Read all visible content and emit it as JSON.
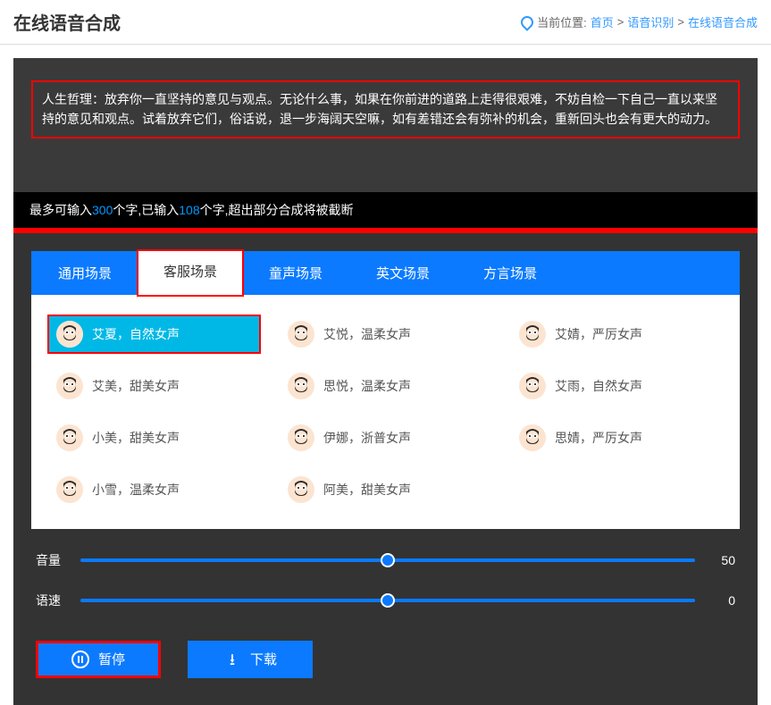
{
  "header": {
    "title": "在线语音合成",
    "breadcrumb": {
      "label": "当前位置:",
      "items": [
        "首页",
        "语音识别",
        "在线语音合成"
      ]
    }
  },
  "textarea": {
    "value": "人生哲理：放弃你一直坚持的意见与观点。无论什么事，如果在你前进的道路上走得很艰难，不妨自检一下自己一直以来坚持的意见和观点。试着放弃它们，俗话说，退一步海阔天空嘛，如有差错还会有弥补的机会，重新回头也会有更大的动力。"
  },
  "counter": {
    "prefix": "最多可输入",
    "max": "300",
    "mid1": "个字,已输入",
    "current": "108",
    "suffix": "个字,超出部分合成将被截断"
  },
  "tabs": [
    {
      "label": "通用场景",
      "active": false
    },
    {
      "label": "客服场景",
      "active": true
    },
    {
      "label": "童声场景",
      "active": false
    },
    {
      "label": "英文场景",
      "active": false
    },
    {
      "label": "方言场景",
      "active": false
    }
  ],
  "voices": [
    {
      "label": "艾夏，自然女声",
      "selected": true
    },
    {
      "label": "艾悦，温柔女声",
      "selected": false
    },
    {
      "label": "艾婧，严厉女声",
      "selected": false
    },
    {
      "label": "艾美，甜美女声",
      "selected": false
    },
    {
      "label": "思悦，温柔女声",
      "selected": false
    },
    {
      "label": "艾雨，自然女声",
      "selected": false
    },
    {
      "label": "小美，甜美女声",
      "selected": false
    },
    {
      "label": "伊娜，浙普女声",
      "selected": false
    },
    {
      "label": "思婧，严厉女声",
      "selected": false
    },
    {
      "label": "小雪，温柔女声",
      "selected": false
    },
    {
      "label": "阿美，甜美女声",
      "selected": false
    }
  ],
  "sliders": {
    "volume": {
      "label": "音量",
      "value": "50",
      "percent": 50
    },
    "speed": {
      "label": "语速",
      "value": "0",
      "percent": 50
    }
  },
  "actions": {
    "pause": "暂停",
    "download": "下载"
  }
}
